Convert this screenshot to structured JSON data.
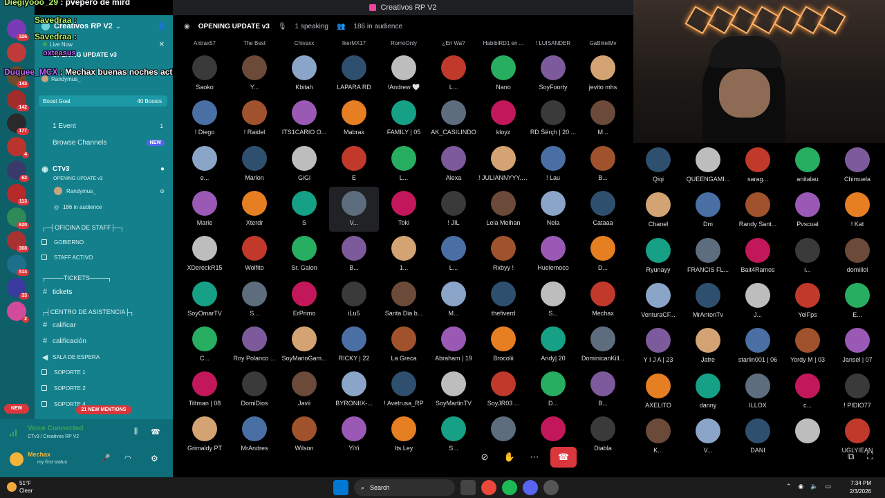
{
  "window": {
    "title": "Creativos RP V2"
  },
  "overlay_chat": [
    {
      "user": "Diegiyooo_29",
      "message": " : pvepero de mird"
    },
    {
      "user": "Savedraa",
      "message": " :"
    },
    {
      "user": "Savedraa",
      "message": " :"
    },
    {
      "user": "oxteasus",
      "message": ""
    },
    {
      "user": "Duquee_MCX",
      "message": " : Mechax buenas noches activo"
    }
  ],
  "sidebar": {
    "server_name": "Creativos RP V2",
    "live_now": "Live Now",
    "live_stage": "OPENING UPDATE v3",
    "live_user": "Randymus_",
    "boost_goal": "Boost Goal",
    "boost_count": "40 Boosts",
    "events": {
      "label": "1 Event",
      "count": "1"
    },
    "browse_channels": {
      "label": "Browse Channels",
      "badge": "NEW"
    },
    "stage_channel": {
      "name": "CTv3",
      "topic": "OPENING UPDATE v3",
      "speaker": "Randymus_",
      "audience": "186 in audience"
    },
    "categories": [
      {
        "label": "┌─┤OFICINA DE STAFF├─┐"
      },
      {
        "label": "┌────TICKETS────┐"
      },
      {
        "label": "┌┤CENTRO DE ASISTENCIA├┐"
      }
    ],
    "staff_channels": [
      "GOBIERNO",
      "STAFF ACTIVO"
    ],
    "tickets_channel": "tickets",
    "assist_channels": [
      "calificar",
      "calificación",
      "SALA DE ESPERA",
      "SOPORTE 1",
      "SOPORTE 2",
      "SOPORTE 4"
    ],
    "mentions": "21 NEW MENTIONS",
    "new_badge": "NEW"
  },
  "server_badges": [
    "326",
    "143",
    "142",
    "177",
    "4",
    "62",
    "113",
    "620",
    "308",
    "514",
    "33",
    "2"
  ],
  "voice": {
    "status": "Voice Connected",
    "channel": "CTv3 / Creativos RP V2",
    "username": "Mechax",
    "custom_status": "my first status"
  },
  "stage": {
    "title": "OPENING UPDATE v3",
    "speaking": "1 speaking",
    "audience": "186 in audience",
    "top_names": [
      "Antrax57",
      "The Best",
      "Chivaxx",
      "IkerMX17",
      "RomoOnly",
      "¿Eri Wa?",
      "HabibiRD1 en ...",
      "! LUISANDER",
      "GaBriielMv"
    ],
    "rows": [
      [
        "Saoko",
        "Y...",
        "Kbitah",
        "LAPARA RD",
        "!Andrew 🤍",
        "L...",
        "Nano",
        "SoyFoorty",
        "jevito mhs"
      ],
      [
        "! Diego",
        "! Raidel",
        "ITS1CARIO O...",
        "Mabrax",
        "FAMILY | 05",
        "AK_CASILINDO",
        "kloyz",
        "RD Šërçh | 20 ...",
        "M..."
      ],
      [
        "e...",
        "Marlon",
        "GiGi",
        "E",
        "L...",
        "Alexa",
        "! JULIANNYYY. (...",
        "! Lau",
        "B..."
      ],
      [
        "Marie",
        "Xterdr",
        "S",
        "V...",
        "Toki",
        "! JIL",
        "Lela Meihan",
        "Nela",
        "Cataaa"
      ],
      [
        "XDereckR15",
        "Wolfito",
        "Sr. Galon",
        "B...",
        "1...",
        "L...",
        "Rxbyy !",
        "Huelemoco",
        "D..."
      ],
      [
        "SoyOmarTV",
        "S...",
        "ErPrimo",
        "iLu5",
        "Santa Dia b...",
        "M...",
        "thefiverd",
        "S...",
        "Mechax"
      ],
      [
        "C...",
        "Roy Polanco ...",
        "SoyMarioGam...",
        "RICKY | 22",
        "La Greca",
        "Abraham | 19",
        "Brocolii",
        "Andy| 20",
        "DominicanKill..."
      ],
      [
        "Tiltman | 08",
        "DomiDios",
        "Javii",
        "BYRONIIX-...",
        "! Avetrusa_RP",
        "SoyMartinTV",
        "SoyJR03 ...",
        "D...",
        "B..."
      ],
      [
        "Grimaldy PT",
        "MrAndres",
        "Wilson",
        "YiYi",
        "Its.Ley",
        "S...",
        "",
        "",
        "Diabla"
      ]
    ],
    "right_rows": [
      [
        "Qiqi",
        "QUEENGAMI...",
        "sarag...",
        "anitalau",
        "Chimuela"
      ],
      [
        "Chanel",
        "Dm",
        "Randy Sant...",
        "Pvscual",
        "! Kat"
      ],
      [
        "Ryunayy",
        "FRANCIS FL...",
        "Bait4Ramos",
        "i...",
        "domiilol"
      ],
      [
        "VenturaCF...",
        "MrAntonTv",
        "J...",
        "YelFps",
        "E..."
      ],
      [
        "Y I J A | 23",
        "Jafre",
        "starlin001 | 06",
        "Yordy M | 03",
        "Jansel | 07"
      ],
      [
        "AXELITO",
        "danny",
        "ILLOX",
        "c...",
        "! PIDIO77"
      ],
      [
        "K...",
        "V...",
        "DANI",
        "",
        "UGLYIEAN"
      ]
    ]
  },
  "taskbar": {
    "weather_temp": "51°F",
    "weather_desc": "Clear",
    "search_placeholder": "Search",
    "time": "7:34 PM",
    "date": "2/3/2026"
  },
  "colors": {
    "sidebar": "#14808c",
    "rail": "#0f5f69",
    "accent": "#5865f2",
    "danger": "#da373c"
  }
}
